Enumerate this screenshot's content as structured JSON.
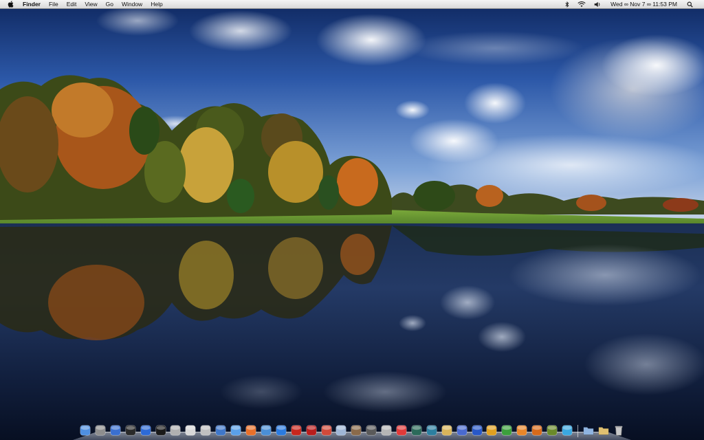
{
  "menubar": {
    "app_name": "Finder",
    "items": [
      "File",
      "Edit",
      "View",
      "Go",
      "Window",
      "Help"
    ],
    "clock": "Wed ∞ Nov 7 ∞ 11:53 PM"
  },
  "icons": {
    "apple": "apple-icon",
    "bluetooth": "bluetooth-icon",
    "wifi": "wifi-icon",
    "volume": "volume-icon",
    "spotlight": "spotlight-search-icon"
  },
  "dock": {
    "apps": [
      {
        "icon": "finder-icon",
        "color": "#4f8fe0"
      },
      {
        "icon": "screenshot-utility-icon",
        "color": "#8e8e8e"
      },
      {
        "icon": "wifi-settings-icon",
        "color": "#3a6fd0"
      },
      {
        "icon": "activity-monitor-icon",
        "color": "#2a2a2a"
      },
      {
        "icon": "globe-app-icon",
        "color": "#2d6ad6"
      },
      {
        "icon": "terminal-icon",
        "color": "#1a1a1a"
      },
      {
        "icon": "disk-utility-icon",
        "color": "#b0b0b0"
      },
      {
        "icon": "script-editor-icon",
        "color": "#d8d8d8"
      },
      {
        "icon": "directory-utility-icon",
        "color": "#c0c0c0"
      },
      {
        "icon": "preview-icon",
        "color": "#3f77c9"
      },
      {
        "icon": "safari-icon",
        "color": "#5aa0e8"
      },
      {
        "icon": "firefox-icon",
        "color": "#e8702a"
      },
      {
        "icon": "system-globe-icon",
        "color": "#4a8fd6"
      },
      {
        "icon": "transmit-icon",
        "color": "#2b7be0"
      },
      {
        "icon": "red-chair-icon",
        "color": "#c8261d"
      },
      {
        "icon": "photo-booth-icon",
        "color": "#b81d1d"
      },
      {
        "icon": "photo-app-icon",
        "color": "#d04a3a"
      },
      {
        "icon": "upload-app-icon",
        "color": "#9fb6d6"
      },
      {
        "icon": "cowboy-hat-icon",
        "color": "#8a6a4a"
      },
      {
        "icon": "dashboard-icon",
        "color": "#5a5a5a"
      },
      {
        "icon": "lock-utility-icon",
        "color": "#b5b5b5"
      },
      {
        "icon": "calculator-app-icon",
        "color": "#e03a3a"
      },
      {
        "icon": "time-machine-icon",
        "color": "#2c6a5a"
      },
      {
        "icon": "chess-icon",
        "color": "#2c7fa0"
      },
      {
        "icon": "notes-icon",
        "color": "#d8b45a"
      },
      {
        "icon": "feather-icon",
        "color": "#4a6ad0"
      },
      {
        "icon": "word-processor-icon",
        "color": "#2858c8"
      },
      {
        "icon": "piano-icon",
        "color": "#e0a020"
      },
      {
        "icon": "green-app-icon",
        "color": "#3ca03c"
      },
      {
        "icon": "orange-app-icon",
        "color": "#e8862a"
      },
      {
        "icon": "pages-icon",
        "color": "#d86a1a"
      },
      {
        "icon": "figure-app-icon",
        "color": "#6a8a2a"
      },
      {
        "icon": "snowflake-icon",
        "color": "#3aa8e0"
      }
    ],
    "stacks": [
      {
        "icon": "folder-icon",
        "color": "#8fb4e0"
      },
      {
        "icon": "downloads-folder-icon",
        "color": "#e0c070"
      },
      {
        "icon": "trash-icon",
        "color": "#c8c8c8"
      }
    ]
  }
}
